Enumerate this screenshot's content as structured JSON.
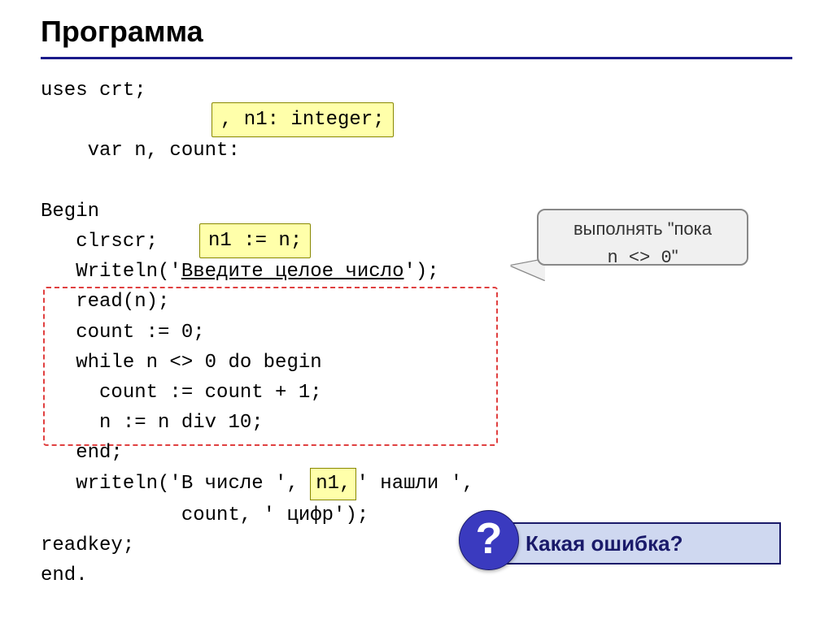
{
  "title": "Программа",
  "code": {
    "l1": "uses crt;",
    "l2": "var n, count:",
    "l3": "Begin",
    "l4": "   clrscr;",
    "l5a": "   Writeln('",
    "l5u": "Введите целое число",
    "l5b": "');",
    "l6": "   read(n);",
    "l7": "   count := 0;",
    "l8": "   while n <> 0 do begin",
    "l9": "     count := count + 1;",
    "l10": "     n := n div 10;",
    "l11": "   end;",
    "l12a": "   writeln('В числе ', ",
    "l12b": "' нашли ',",
    "l13": "            count, ' цифр');",
    "l14": "readkey;",
    "l15": "end."
  },
  "highlights": {
    "h1": ", n1: integer;",
    "h2": "n1 := n;",
    "h3": "n1,"
  },
  "note": {
    "line1": "выполнять \"пока",
    "line2_prefix": "n <> 0",
    "line2_suffix": "\""
  },
  "error": {
    "symbol": "?",
    "text": "Какая ошибка?"
  }
}
